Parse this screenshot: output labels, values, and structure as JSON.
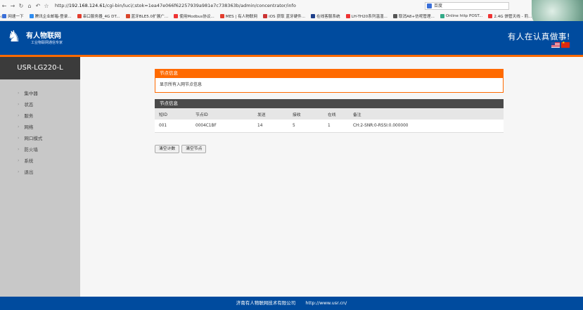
{
  "browser": {
    "url_scheme": "http://",
    "url_host": "192.168.124.61",
    "url_path": "/cgi-bin/luci/;stok=1ea47e066f62257939a981e7c738363b/admin/concentrator/info",
    "search_text": "百度",
    "bookmarks": [
      {
        "label": "网速一下",
        "color": "#3a6fd8"
      },
      {
        "label": "腾讯企业邮箱-登录...",
        "color": "#2d8cf0"
      },
      {
        "label": "串口服务器_4G DT...",
        "color": "#e23d2e"
      },
      {
        "label": "蓝牙BLE5.0扩展广...",
        "color": "#d9452b"
      },
      {
        "label": "使用Modbus协议...",
        "color": "#e33"
      },
      {
        "label": "MES | 有人物联网",
        "color": "#e23d2e"
      },
      {
        "label": "iOS 获取 蓝牙硬件...",
        "color": "#c33"
      },
      {
        "label": "在线客服系统",
        "color": "#1e3f8a"
      },
      {
        "label": "LH-TH20系列温湿...",
        "color": "#e33"
      },
      {
        "label": "取消A8+仿呢管理...",
        "color": "#555"
      },
      {
        "label": "Online http POST...",
        "color": "#3a8"
      },
      {
        "label": "2.4G 馈管天线 - 莉...",
        "color": "#e33"
      }
    ]
  },
  "header": {
    "logo_title": "有人物联网",
    "logo_sub": "工业物联网通信专家",
    "slogan": "有人在认真做事!"
  },
  "sidebar": {
    "title": "USR-LG220-L",
    "items": [
      {
        "label": "集中器"
      },
      {
        "label": "状态"
      },
      {
        "label": "服务"
      },
      {
        "label": "网络"
      },
      {
        "label": "网口模式"
      },
      {
        "label": "防火墙"
      },
      {
        "label": "系统"
      },
      {
        "label": "退出"
      }
    ]
  },
  "panel1": {
    "title": "节点信息",
    "desc": "显示所有入网节点信息"
  },
  "panel2": {
    "title": "节点信息",
    "columns": [
      "短ID",
      "节点ID",
      "发送",
      "接收",
      "在线",
      "备注"
    ],
    "rows": [
      [
        "001",
        "0004C1BF",
        "14",
        "5",
        "1",
        "CH:2-SNR:0-RSSI:0.000000"
      ]
    ]
  },
  "buttons": {
    "clear_count": "清空计数",
    "clear_nodes": "清空节点"
  },
  "footer": {
    "company": "济南有人物联网技术有限公司",
    "url": "http://www.usr.cn/"
  }
}
